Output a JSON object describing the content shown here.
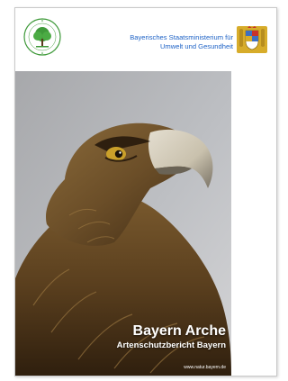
{
  "header": {
    "ministry_line1": "Bayerisches Staatsministerium für",
    "ministry_line2": "Umwelt und Gesundheit",
    "tree_logo_icon": "tree-logo-icon",
    "crest_icon": "bavarian-crest-icon"
  },
  "cover": {
    "title": "Bayern Arche",
    "subtitle": "Artenschutzbericht Bayern",
    "url": "www.natur.bayern.de"
  },
  "colors": {
    "ministry_text": "#1f63c6",
    "logo_green": "#3f9a3a",
    "crest_gold": "#d7ac2a",
    "crest_blue": "#3d6fc2"
  }
}
